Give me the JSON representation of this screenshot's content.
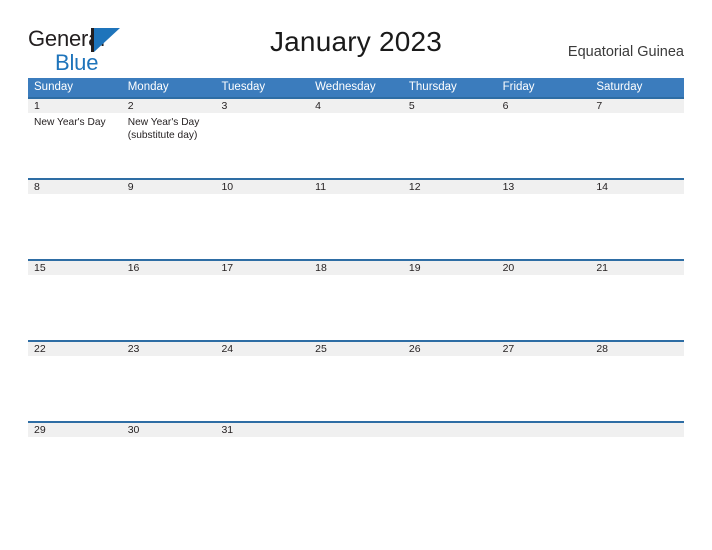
{
  "brand": {
    "name_part1": "General",
    "name_part2": "Blue",
    "flag_icon": "flag-icon",
    "accent_color": "#1e74bb",
    "dark_color": "#231f20"
  },
  "header": {
    "title": "January 2023",
    "locale": "Equatorial Guinea"
  },
  "calendar": {
    "header_bg": "#3b7cbd",
    "date_band_bg": "#f0f0f0",
    "date_band_border": "#2e6da4",
    "weekdays": [
      "Sunday",
      "Monday",
      "Tuesday",
      "Wednesday",
      "Thursday",
      "Friday",
      "Saturday"
    ],
    "weeks": [
      {
        "days": [
          {
            "date": "1",
            "event": "New Year's Day"
          },
          {
            "date": "2",
            "event": "New Year's Day (substitute day)"
          },
          {
            "date": "3",
            "event": ""
          },
          {
            "date": "4",
            "event": ""
          },
          {
            "date": "5",
            "event": ""
          },
          {
            "date": "6",
            "event": ""
          },
          {
            "date": "7",
            "event": ""
          }
        ]
      },
      {
        "days": [
          {
            "date": "8",
            "event": ""
          },
          {
            "date": "9",
            "event": ""
          },
          {
            "date": "10",
            "event": ""
          },
          {
            "date": "11",
            "event": ""
          },
          {
            "date": "12",
            "event": ""
          },
          {
            "date": "13",
            "event": ""
          },
          {
            "date": "14",
            "event": ""
          }
        ]
      },
      {
        "days": [
          {
            "date": "15",
            "event": ""
          },
          {
            "date": "16",
            "event": ""
          },
          {
            "date": "17",
            "event": ""
          },
          {
            "date": "18",
            "event": ""
          },
          {
            "date": "19",
            "event": ""
          },
          {
            "date": "20",
            "event": ""
          },
          {
            "date": "21",
            "event": ""
          }
        ]
      },
      {
        "days": [
          {
            "date": "22",
            "event": ""
          },
          {
            "date": "23",
            "event": ""
          },
          {
            "date": "24",
            "event": ""
          },
          {
            "date": "25",
            "event": ""
          },
          {
            "date": "26",
            "event": ""
          },
          {
            "date": "27",
            "event": ""
          },
          {
            "date": "28",
            "event": ""
          }
        ]
      },
      {
        "days": [
          {
            "date": "29",
            "event": ""
          },
          {
            "date": "30",
            "event": ""
          },
          {
            "date": "31",
            "event": ""
          },
          {
            "date": "",
            "event": ""
          },
          {
            "date": "",
            "event": ""
          },
          {
            "date": "",
            "event": ""
          },
          {
            "date": "",
            "event": ""
          }
        ]
      }
    ]
  }
}
